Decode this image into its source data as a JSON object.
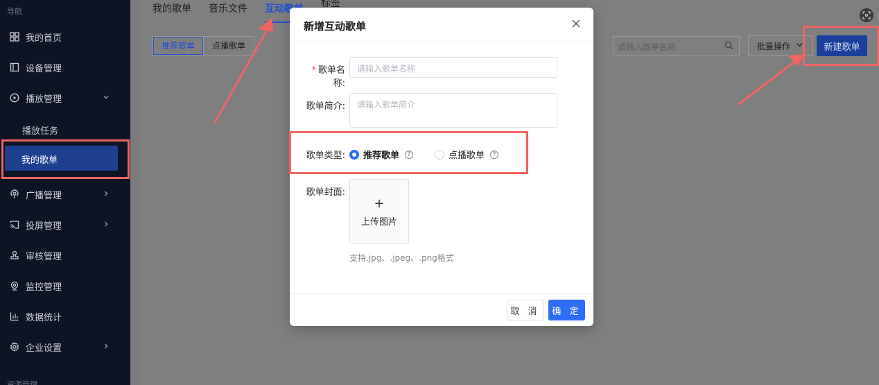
{
  "sidebar": {
    "header": "导航",
    "items": [
      {
        "label": "我的首页",
        "icon": "grid-icon"
      },
      {
        "label": "设备管理",
        "icon": "device-icon"
      },
      {
        "label": "播放管理",
        "icon": "play-circle-icon"
      },
      {
        "label": "广播管理",
        "icon": "broadcast-icon"
      },
      {
        "label": "投屏管理",
        "icon": "cast-icon"
      },
      {
        "label": "审核管理",
        "icon": "stamp-icon"
      },
      {
        "label": "监控管理",
        "icon": "camera-icon"
      },
      {
        "label": "数据统计",
        "icon": "bar-chart-icon"
      },
      {
        "label": "企业设置",
        "icon": "gear-icon"
      }
    ],
    "sub_items": [
      {
        "label": "播放任务"
      },
      {
        "label": "我的歌单"
      }
    ],
    "bottom_text": "资源管理"
  },
  "tabs": [
    "我的歌单",
    "音乐文件",
    "互动歌单",
    "标签"
  ],
  "segment": {
    "items": [
      "推荐歌单",
      "点播歌单"
    ]
  },
  "search": {
    "placeholder": "请输入歌单名称"
  },
  "toolbar": {
    "batch_label": "批量操作",
    "new_label": "新建歌单"
  },
  "modal": {
    "title": "新增互动歌单",
    "name_label": "歌单名称:",
    "name_placeholder": "请输入歌单名称",
    "intro_label": "歌单简介:",
    "intro_placeholder": "请输入歌单简介",
    "type_label": "歌单类型:",
    "type_option_1": "推荐歌单",
    "type_option_2": "点播歌单",
    "cover_label": "歌单封面:",
    "upload_plus": "+",
    "upload_label": "上传图片",
    "upload_hint": "支持.jpg、.jpeg、.png格式",
    "cancel_label": "取 消",
    "ok_label": "确 定"
  },
  "colors": {
    "primary": "#2f6df6",
    "annotation": "#f06464",
    "sidebar_bg": "#0e1424"
  }
}
